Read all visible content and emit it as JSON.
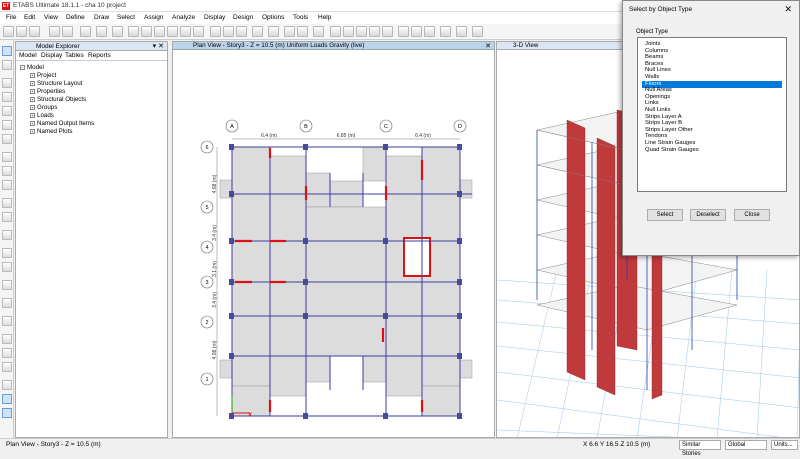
{
  "app": {
    "logo": "ET",
    "title": "ETABS Ultimate 18.1.1 - cha 10 project"
  },
  "menu": [
    "File",
    "Edit",
    "View",
    "Define",
    "Draw",
    "Select",
    "Assign",
    "Analyze",
    "Display",
    "Design",
    "Options",
    "Tools",
    "Help"
  ],
  "explorer": {
    "title": "Model Explorer",
    "tabs": [
      "Model",
      "Display",
      "Tables",
      "Reports"
    ],
    "root": "Model",
    "items": [
      "Project",
      "Structure Layout",
      "Properties",
      "Structural Objects",
      "Groups",
      "Loads",
      "Named Output Items",
      "Named Plots"
    ]
  },
  "plan": {
    "title": "Plan View - Story3 - Z = 10.5 (m)  Uniform Loads Gravity  (live)",
    "grid_cols": [
      "A",
      "B",
      "C",
      "D"
    ],
    "grid_rows": [
      "6",
      "5",
      "4",
      "3",
      "2",
      "1"
    ],
    "col_dims": [
      "6.4 (m)",
      "6.85 (m)",
      "6.4 (m)"
    ],
    "row_dims": [
      "4.98 (m)",
      "3.4 (m)",
      "3.1 (m)",
      "3.4 (m)",
      "4.98 (m)"
    ]
  },
  "view3d": {
    "title": "3-D View"
  },
  "dialog": {
    "title": "Select by Object Type",
    "group_label": "Object Type",
    "options": [
      "Joints",
      "Columns",
      "Beams",
      "Braces",
      "Null Lines",
      "Walls",
      "Floors",
      "Null Areas",
      "Openings",
      "Links",
      "Null Links",
      "Strips Layer A",
      "Strips Layer B",
      "Strips Layer Other",
      "Tendons",
      "Line Strain Gauges",
      "Quad Strain Gauges"
    ],
    "selected": "Floors",
    "buttons": {
      "select": "Select",
      "deselect": "Deselect",
      "close": "Close"
    }
  },
  "status": {
    "left": "Plan View - Story3 - Z = 10.5 (m)",
    "coords": "X 6.6  Y 16.5  Z 10.5 (m)",
    "stories": "Similar Stories",
    "csys": "Global",
    "units": "Units..."
  }
}
